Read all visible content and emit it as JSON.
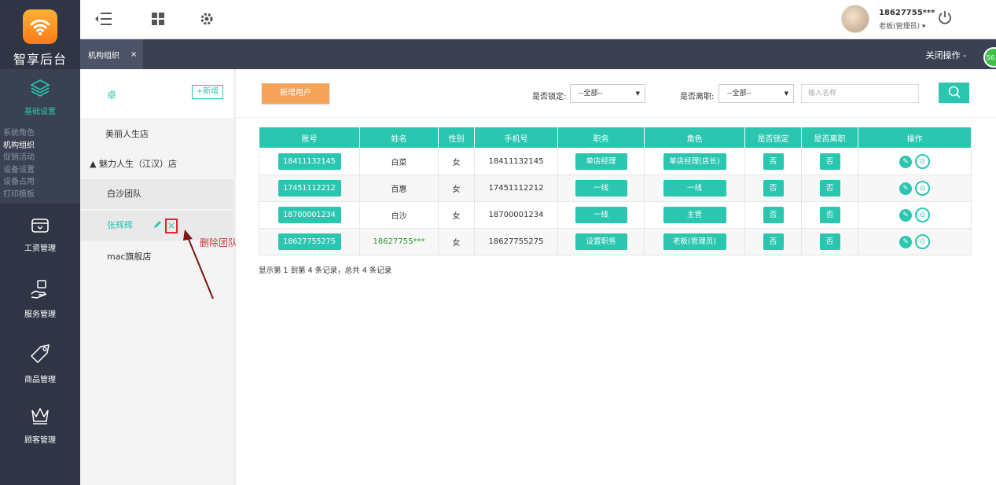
{
  "brand": {
    "name": "智享后台",
    "color": "#ff8f23"
  },
  "sidebar": {
    "active": {
      "label": "基础设置",
      "icon": "layers-icon"
    },
    "subitems": [
      "系统角色",
      "机构组织",
      "促销活动",
      "设备设置",
      "设备占用",
      "打印模板"
    ],
    "active_subitem": "机构组织",
    "items": [
      {
        "label": "工资管理",
        "icon": "wallet-icon"
      },
      {
        "label": "服务管理",
        "icon": "hand-service-icon"
      },
      {
        "label": "商品管理",
        "icon": "price-tag-icon"
      },
      {
        "label": "顾客管理",
        "icon": "crown-icon"
      }
    ]
  },
  "header": {
    "user_name": "18627755***",
    "user_role": "老板(管理员) ▾",
    "icons": [
      "menu-collapse-icon",
      "grid-icon",
      "gear-icon",
      "power-icon"
    ]
  },
  "tabs": {
    "items": [
      {
        "label": "机构组织",
        "close": "×"
      }
    ],
    "close_ops": "关闭操作 -",
    "badge": "56"
  },
  "tree": {
    "title": "卓",
    "add_label": "+新增",
    "nodes": [
      {
        "label": "美丽人生店"
      },
      {
        "label": "▲  魅力人生（江汉）店"
      },
      {
        "label": "白沙团队"
      },
      {
        "label": "张辉辉"
      },
      {
        "label": "mac旗舰店"
      }
    ],
    "delete_icon": "×",
    "edit_icon": "pencil-icon"
  },
  "annotation": {
    "text": "删除团队",
    "color": "#d4363c"
  },
  "toolbar": {
    "new_user": "新增用户",
    "locked_label": "是否锁定:",
    "locked_value": "--全部--",
    "resigned_label": "是否离职:",
    "resigned_value": "--全部--",
    "search_placeholder": "输入名称"
  },
  "table": {
    "headers": [
      "账号",
      "姓名",
      "性别",
      "手机号",
      "职务",
      "角色",
      "是否锁定",
      "是否离职",
      "操作"
    ],
    "rows": [
      {
        "account": "18411132145",
        "name": "白菜",
        "gender": "女",
        "phone": "18411132145",
        "position": "单店经理",
        "role": "单店经理(店长)",
        "locked": "否",
        "resigned": "否"
      },
      {
        "account": "17451112212",
        "name": "百惠",
        "gender": "女",
        "phone": "17451112212",
        "position": "一线",
        "role": "一线",
        "locked": "否",
        "resigned": "否"
      },
      {
        "account": "18700001234",
        "name": "白沙",
        "gender": "女",
        "phone": "18700001234",
        "position": "一线",
        "role": "主管",
        "locked": "否",
        "resigned": "否"
      },
      {
        "account": "18627755275",
        "name": "18627755***",
        "gender": "女",
        "phone": "18627755275",
        "position": "设置职务",
        "role": "老板(管理员)",
        "locked": "否",
        "resigned": "否"
      }
    ],
    "ops_icons": [
      "edit-icon",
      "lock-icon"
    ],
    "summary": "显示第 1 到第 4 条记录，总共 4 条记录"
  },
  "colors": {
    "accent": "#2ac6b0",
    "sidebar": "#2f3545",
    "orange": "#f6a35a"
  }
}
